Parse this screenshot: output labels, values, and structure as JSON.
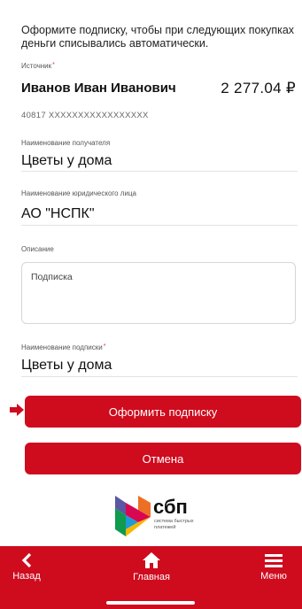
{
  "intro_text": "Оформите подписку, чтобы при следующих покупках деньги списывались автоматически.",
  "source": {
    "label": "Источник",
    "name": "Иванов Иван Иванович",
    "amount": "2 277.04 ₽",
    "account": "40817  XXXXXXXXXXXXXXXXX"
  },
  "recipient": {
    "label": "Наименование получателя",
    "value": "Цветы у дома"
  },
  "legal_entity": {
    "label": "Наименование юридического лица",
    "value": "АО \"НСПК\""
  },
  "description": {
    "label": "Описание",
    "value": "Подписка"
  },
  "subscription_name": {
    "label": "Наименование подписки",
    "value": "Цветы у дома"
  },
  "required_mark": "*",
  "buttons": {
    "subscribe": "Оформить подписку",
    "cancel": "Отмена"
  },
  "logo": {
    "name": "сбп",
    "tagline_1": "система быстрых",
    "tagline_2": "платежей"
  },
  "nav": {
    "back": "Назад",
    "home": "Главная",
    "menu": "Меню"
  },
  "colors": {
    "brand_red": "#cf0b1e"
  }
}
